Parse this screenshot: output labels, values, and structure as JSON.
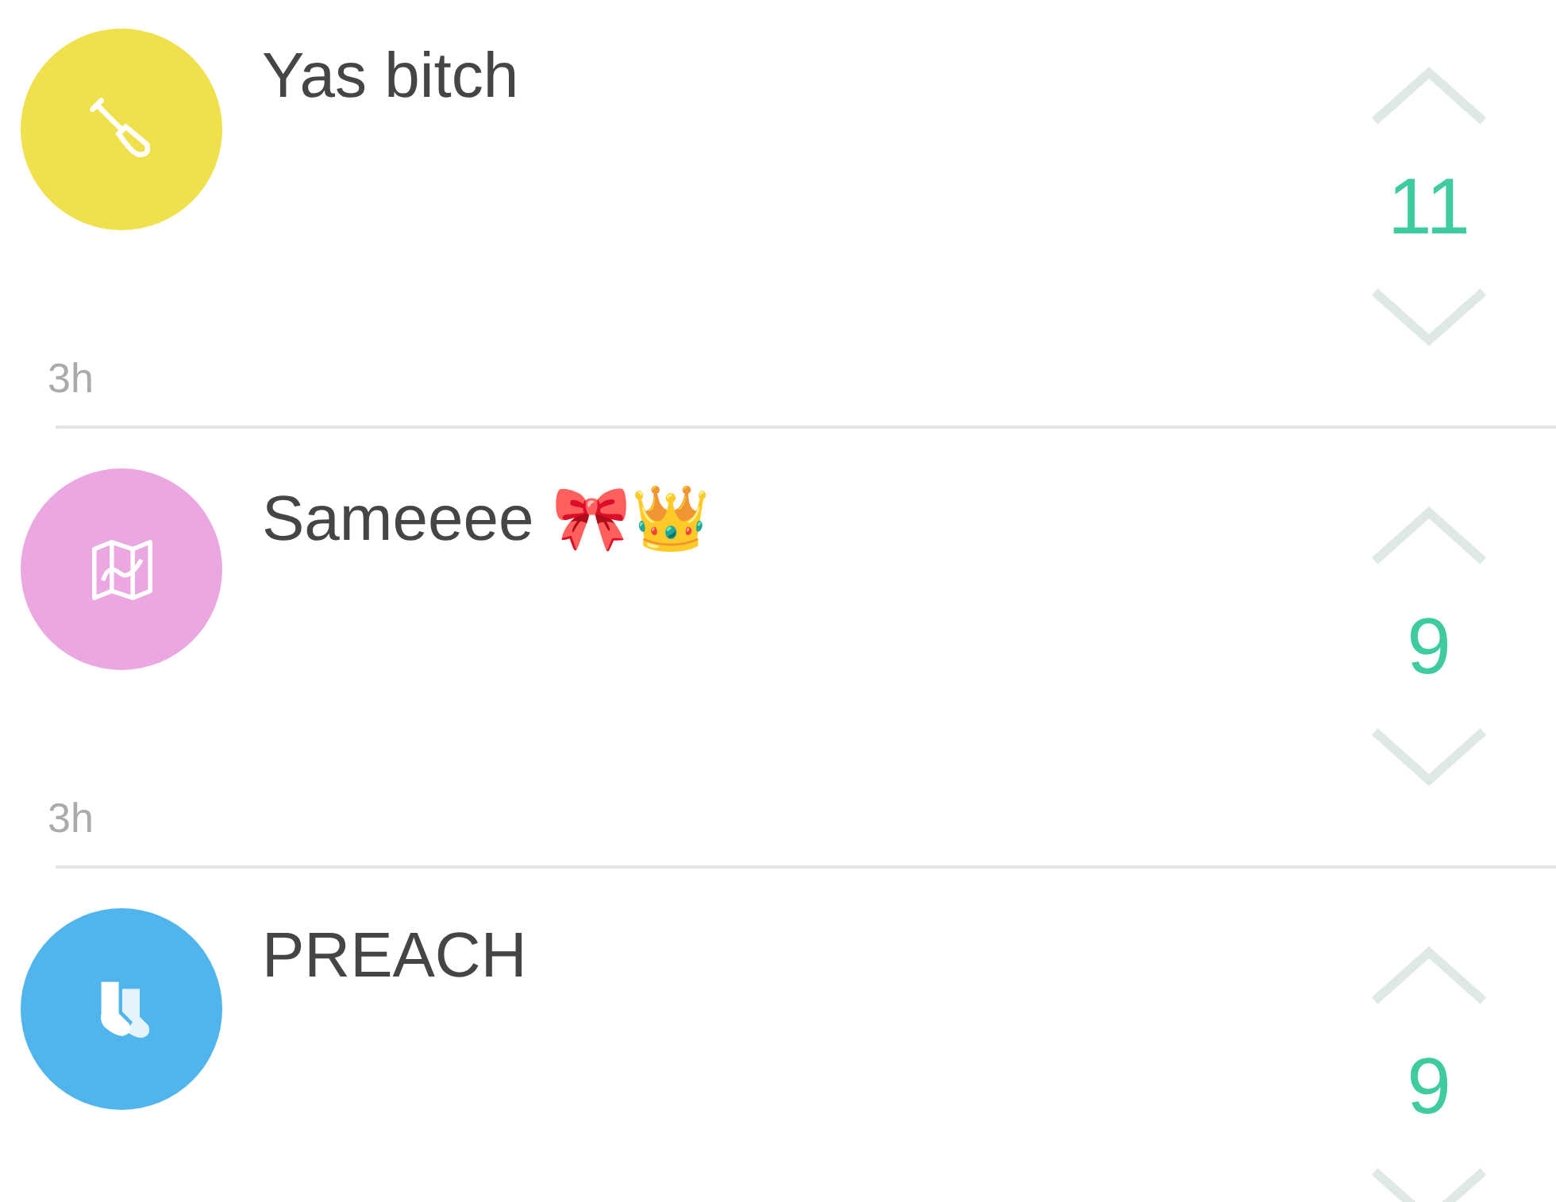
{
  "comments": [
    {
      "text": "Yas bitch",
      "time": "3h",
      "votes": "11",
      "color": "#efe04c"
    },
    {
      "text": "Sameeee 🎀👑",
      "time": "3h",
      "votes": "9",
      "color": "#eaa7e2"
    },
    {
      "text": "PREACH",
      "votes": "9",
      "color": "#50b5ec"
    }
  ]
}
